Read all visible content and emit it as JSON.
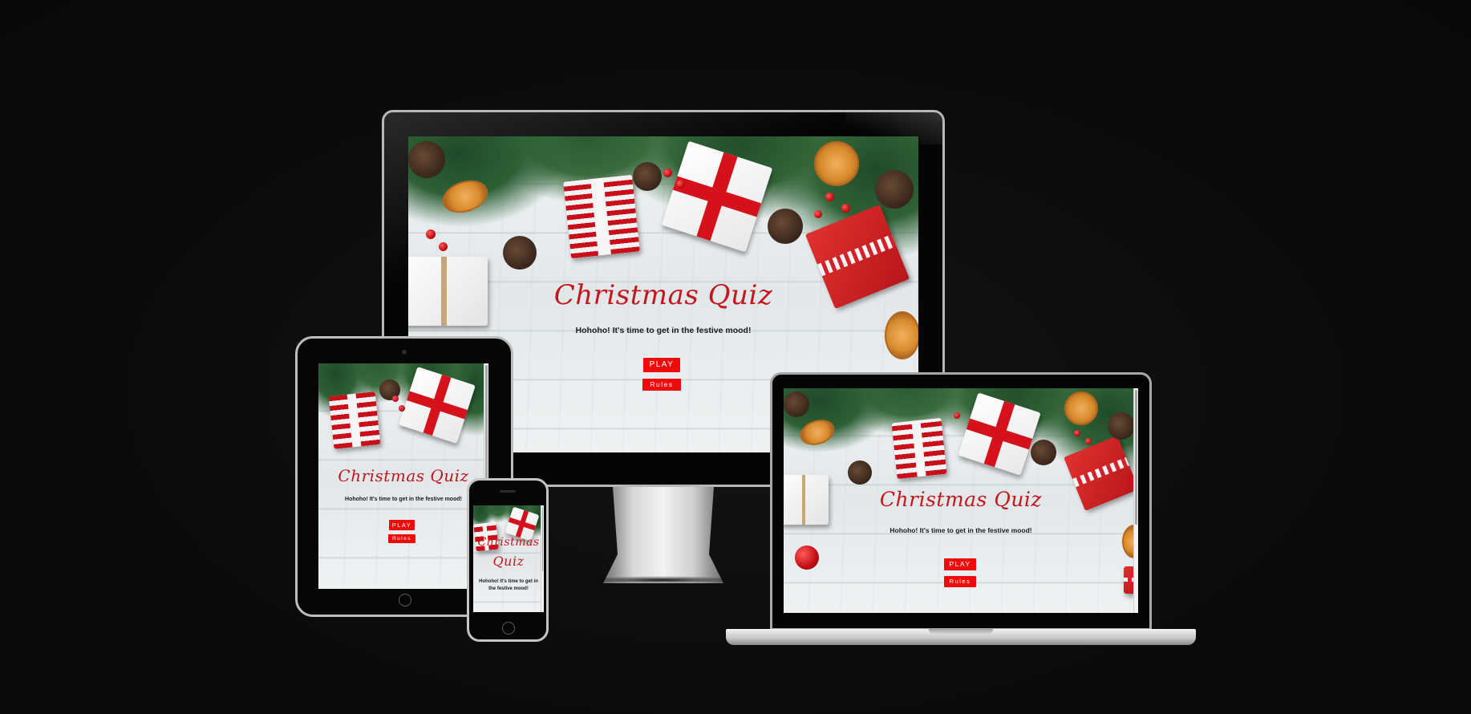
{
  "app": {
    "title": "Christmas Quiz",
    "tagline": "Hohoho! It's time to get in the festive mood!",
    "play_label": "PLAY",
    "rules_label": "Rules"
  },
  "phone_title_lines": [
    "Christmas",
    "Quiz"
  ],
  "phone_tagline_lines": [
    "Hohoho! It's time to get in",
    "the festive mood!"
  ],
  "colors": {
    "background": "#0b0b0c",
    "title_red": "#c4161d",
    "button_red": "#ee0b0b",
    "button_text": "#ffffff",
    "tagline_text": "#1b1b1b"
  },
  "icons": {
    "tablet_home": "home-button-icon",
    "phone_home": "home-button-icon",
    "camera": "camera-icon"
  }
}
